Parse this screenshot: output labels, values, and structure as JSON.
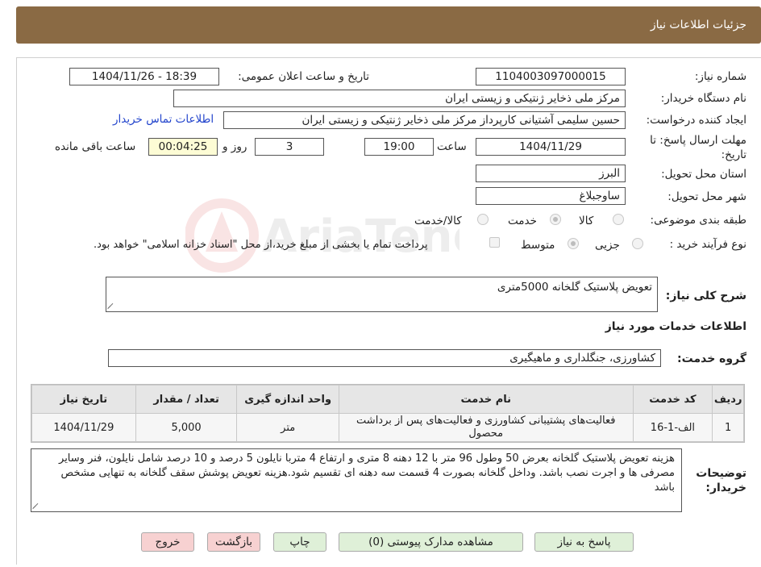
{
  "header": {
    "title": "جزئیات اطلاعات نیاز"
  },
  "fields": {
    "need_number_label": "شماره نیاز:",
    "need_number": "1104003097000015",
    "announce_label": "تاریخ و ساعت اعلان عمومی:",
    "announce_value": "1404/11/26 - 18:39",
    "buyer_org_label": "نام دستگاه خریدار:",
    "buyer_org": "مرکز ملی ذخایر ژنتیکی و زیستی ایران",
    "creator_label": "ایجاد کننده درخواست:",
    "creator": "حسین  سلیمی آشتیانی  کارپرداز مرکز ملی ذخایر ژنتیکی و زیستی ایران",
    "contact_link": "اطلاعات تماس خریدار",
    "deadline_label": "مهلت ارسال پاسخ: تا تاریخ:",
    "deadline_date": "1404/11/29",
    "time_label": "ساعت",
    "deadline_time": "19:00",
    "days_value": "3",
    "days_label": "روز و",
    "remaining_time": "00:04:25",
    "remaining_label": "ساعت باقی مانده",
    "province_label": "استان محل تحویل:",
    "province": "البرز",
    "city_label": "شهر محل تحویل:",
    "city": "ساوجبلاغ",
    "category_label": "طبقه بندی موضوعی:",
    "category_options": [
      "کالا",
      "خدمت",
      "کالا/خدمت"
    ],
    "process_label": "نوع فرآیند خرید :",
    "process_options": [
      "جزیی",
      "متوسط"
    ],
    "payment_note": "پرداخت تمام یا بخشی از مبلغ خرید،از محل \"اسناد خزانه اسلامی\" خواهد بود.",
    "summary_label": "شرح کلی نیاز:",
    "summary": "تعویض پلاستیک گلخانه 5000متری",
    "services_title": "اطلاعات خدمات مورد نیاز",
    "service_group_label": "گروه خدمت:",
    "service_group": "کشاورزی، جنگلداری و ماهیگیری",
    "buyer_notes_label": "توضیحات خریدار:",
    "buyer_notes": "هزینه تعویض پلاستیک گلخانه بعرض 50 وطول 96 متر با 12 دهنه 8 متری و ارتفاع 4 متربا نایلون 5 درصد و 10 درصد شامل نایلون، فنر وسایر مصرفی ها و اجرت نصب باشد. وداخل گلخانه بصورت 4 قسمت سه دهنه ای تقسیم شود.هزینه تعویض پوشش سقف گلخانه به تنهایی مشخص باشد"
  },
  "table": {
    "headers": [
      "ردیف",
      "کد خدمت",
      "نام خدمت",
      "واحد اندازه گیری",
      "تعداد / مقدار",
      "تاریخ نیاز"
    ],
    "rows": [
      [
        "1",
        "الف-1-16",
        "فعالیت‌های پشتیبانی کشاورزی و فعالیت‌های پس از برداشت محصول",
        "متر",
        "5,000",
        "1404/11/29"
      ]
    ]
  },
  "buttons": {
    "reply": "پاسخ به نیاز",
    "attachments": "مشاهده مدارک پیوستی (0)",
    "print": "چاپ",
    "back": "بازگشت",
    "exit": "خروج"
  },
  "watermark": {
    "text": "AriaTender.neT"
  }
}
